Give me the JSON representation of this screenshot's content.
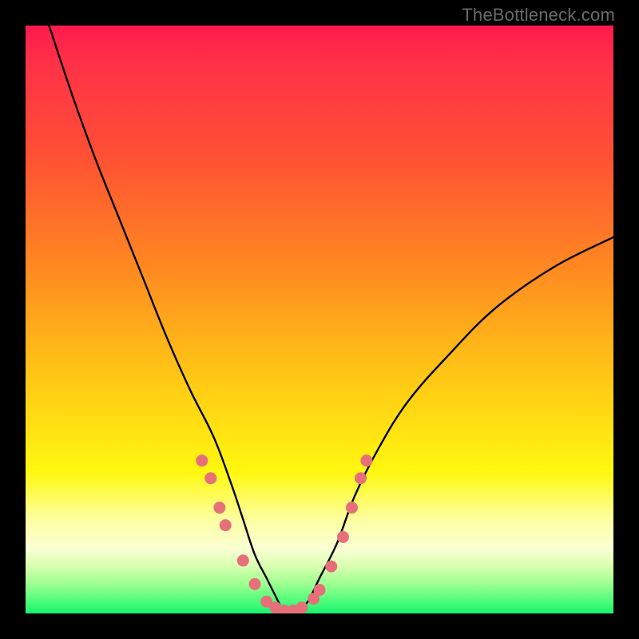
{
  "watermark": "TheBottleneck.com",
  "chart_data": {
    "type": "line",
    "title": "",
    "xlabel": "",
    "ylabel": "",
    "xlim": [
      0,
      100
    ],
    "ylim": [
      0,
      100
    ],
    "series": [
      {
        "name": "bottleneck-curve",
        "x": [
          4,
          8,
          12,
          16,
          20,
          24,
          28,
          32,
          35,
          37,
          39,
          41,
          43,
          44,
          46,
          48,
          50,
          53,
          56,
          60,
          65,
          72,
          80,
          90,
          100
        ],
        "values": [
          100,
          88,
          77,
          67,
          57,
          47,
          38,
          30,
          22,
          16,
          10,
          6,
          2,
          0,
          0,
          2,
          6,
          12,
          20,
          28,
          36,
          44,
          52,
          59,
          64
        ]
      }
    ],
    "markers": {
      "name": "highlight-dots",
      "color": "#e76f7a",
      "points": [
        {
          "x": 30,
          "y": 26
        },
        {
          "x": 31.5,
          "y": 23
        },
        {
          "x": 33,
          "y": 18
        },
        {
          "x": 34,
          "y": 15
        },
        {
          "x": 37,
          "y": 9
        },
        {
          "x": 39,
          "y": 5
        },
        {
          "x": 41,
          "y": 2
        },
        {
          "x": 42.5,
          "y": 1
        },
        {
          "x": 44,
          "y": 0.5
        },
        {
          "x": 45.5,
          "y": 0.5
        },
        {
          "x": 47,
          "y": 1
        },
        {
          "x": 49,
          "y": 2.5
        },
        {
          "x": 50,
          "y": 4
        },
        {
          "x": 52,
          "y": 8
        },
        {
          "x": 54,
          "y": 13
        },
        {
          "x": 55.5,
          "y": 18
        },
        {
          "x": 57,
          "y": 23
        },
        {
          "x": 58,
          "y": 26
        }
      ]
    },
    "background_gradient": {
      "top": "#ff1a4d",
      "mid": "#ffe012",
      "bottom": "#18f26e"
    }
  }
}
